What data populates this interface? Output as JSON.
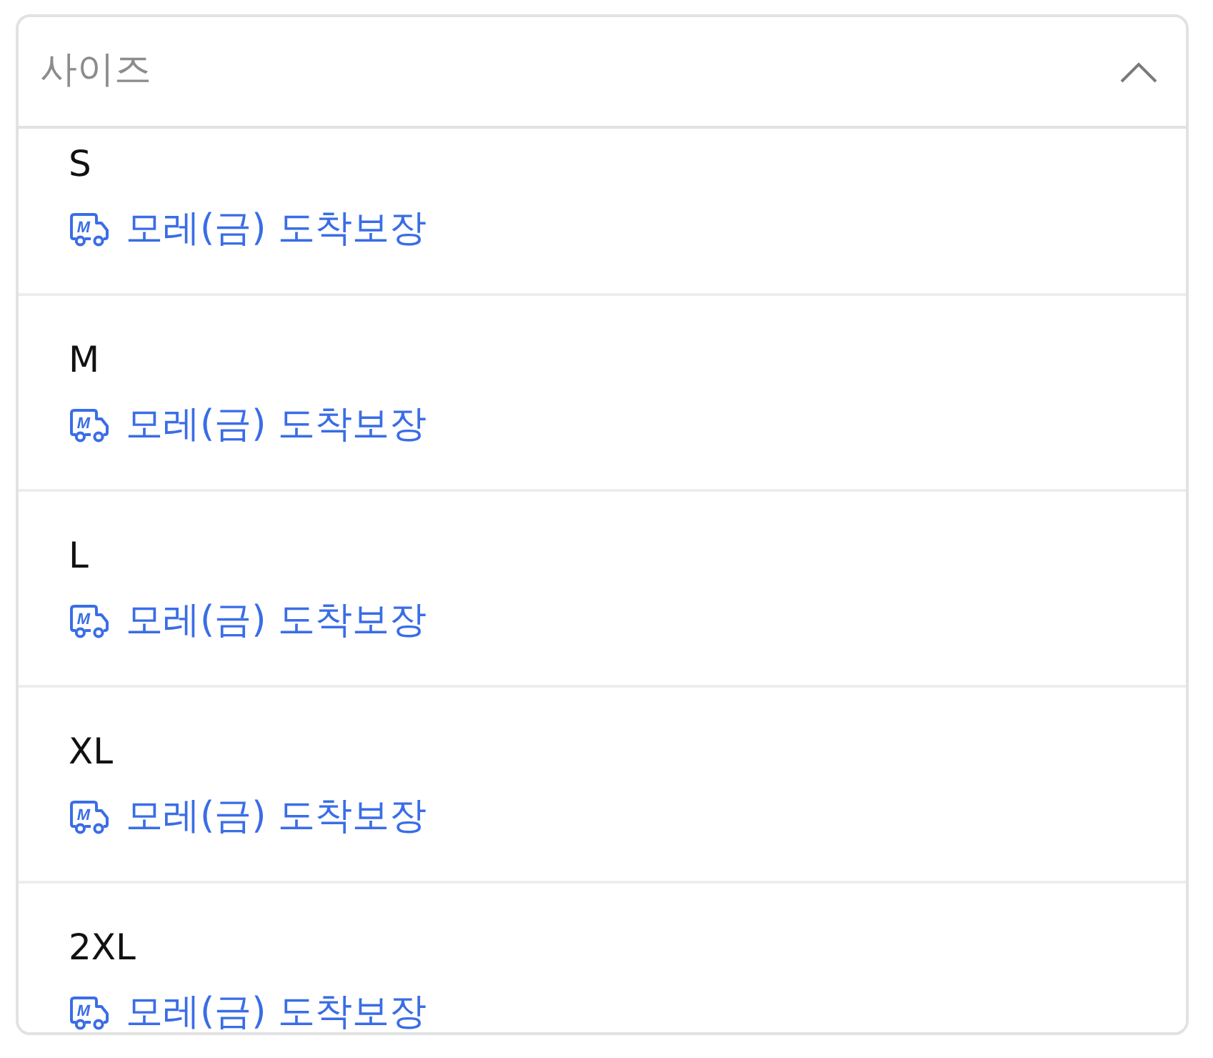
{
  "select": {
    "placeholder": "사이즈",
    "expanded": true
  },
  "options": [
    {
      "label": "S",
      "selected": false,
      "delivery": {
        "icon_text": "M",
        "text": "모레(금) 도착보장"
      }
    },
    {
      "label": "M",
      "selected": false,
      "delivery": {
        "icon_text": "M",
        "text": "모레(금) 도착보장"
      }
    },
    {
      "label": "L",
      "selected": false,
      "delivery": {
        "icon_text": "M",
        "text": "모레(금) 도착보장"
      }
    },
    {
      "label": "XL",
      "selected": false,
      "delivery": {
        "icon_text": "M",
        "text": "모레(금) 도착보장"
      }
    },
    {
      "label": "2XL",
      "selected": false,
      "delivery": {
        "icon_text": "M",
        "text": "모레(금) 도착보장"
      }
    }
  ]
}
